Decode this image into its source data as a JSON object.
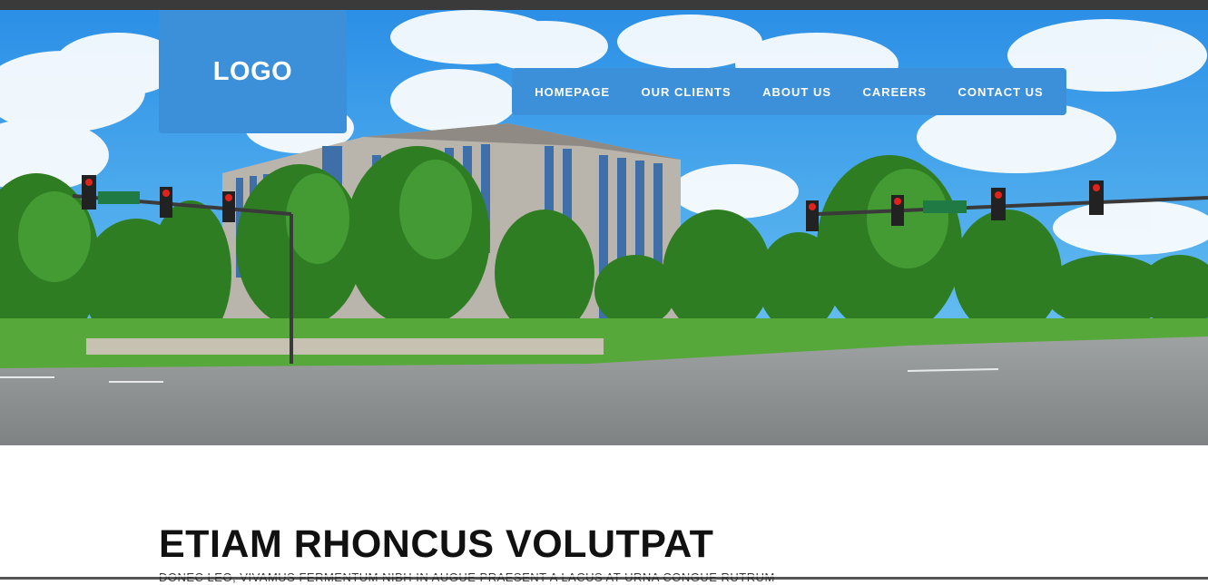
{
  "header": {
    "logo_text": "LOGO"
  },
  "nav": {
    "items": [
      {
        "label": "HOMEPAGE"
      },
      {
        "label": "OUR CLIENTS"
      },
      {
        "label": "ABOUT US"
      },
      {
        "label": "CAREERS"
      },
      {
        "label": "CONTACT US"
      }
    ]
  },
  "content": {
    "headline": "ETIAM RHONCUS VOLUTPAT",
    "subline": "DONEC LEO, VIVAMUS FERMENTUM NIBH IN AUGUE PRAESENT A LACUS AT URNA CONGUE RUTRUM"
  },
  "colors": {
    "accent": "#3c8fd9",
    "text": "#111111",
    "top_bar": "#3a3a3a"
  }
}
